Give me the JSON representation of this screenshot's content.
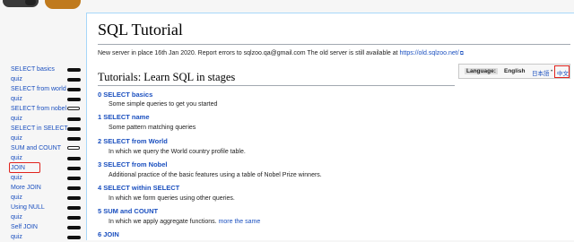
{
  "sidebar": {
    "items": [
      {
        "label": "SELECT basics",
        "progress": "filled"
      },
      {
        "label": "quiz",
        "progress": "filled"
      },
      {
        "label": "SELECT from world",
        "progress": "filled"
      },
      {
        "label": "quiz",
        "progress": "filled"
      },
      {
        "label": "SELECT from nobel",
        "progress": "ring"
      },
      {
        "label": "quiz",
        "progress": "filled"
      },
      {
        "label": "SELECT in SELECT",
        "progress": "filled"
      },
      {
        "label": "quiz",
        "progress": "filled"
      },
      {
        "label": "SUM and COUNT",
        "progress": "ring"
      },
      {
        "label": "quiz",
        "progress": "filled"
      },
      {
        "label": "JOIN",
        "progress": "filled"
      },
      {
        "label": "quiz",
        "progress": "filled"
      },
      {
        "label": "More JOIN",
        "progress": "filled"
      },
      {
        "label": "quiz",
        "progress": "filled"
      },
      {
        "label": "Using NULL",
        "progress": "filled"
      },
      {
        "label": "quiz",
        "progress": "filled"
      },
      {
        "label": "Self JOIN",
        "progress": "filled"
      },
      {
        "label": "quiz",
        "progress": "filled"
      }
    ]
  },
  "page": {
    "title": "SQL Tutorial",
    "notice": "New server in place 16th Jan 2020. Report errors to sqlzoo.qa@gmail.com The old server is still available at ",
    "notice_link": "https://old.sqlzoo.net/",
    "section_title": "Tutorials: Learn SQL in stages"
  },
  "language": {
    "label": "Language:",
    "english": "English",
    "japanese": "日本語",
    "separator": "•",
    "chinese": "中文"
  },
  "tutorials": [
    {
      "title": "0 SELECT basics",
      "desc": "Some simple queries to get you started",
      "extra": ""
    },
    {
      "title": "1 SELECT name",
      "desc": "Some pattern matching queries",
      "extra": ""
    },
    {
      "title": "2 SELECT from World",
      "desc": "In which we query the World country profile table.",
      "extra": ""
    },
    {
      "title": "3 SELECT from Nobel",
      "desc": "Additional practice of the basic features using a table of Nobel Prize winners.",
      "extra": ""
    },
    {
      "title": "4 SELECT within SELECT",
      "desc": "In which we form queries using other queries.",
      "extra": ""
    },
    {
      "title": "5 SUM and COUNT",
      "desc": "In which we apply aggregate functions. ",
      "extra": "more the same"
    },
    {
      "title": "6 JOIN",
      "desc": "",
      "extra": ""
    }
  ]
}
